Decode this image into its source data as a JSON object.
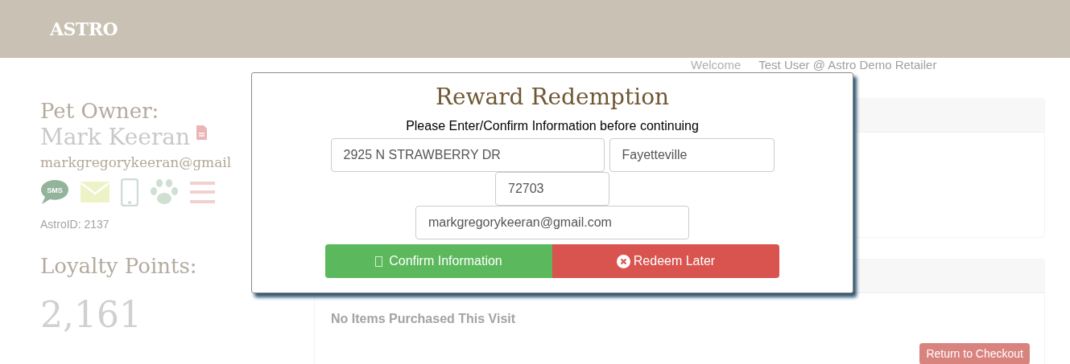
{
  "header": {
    "logo": "ASTRO"
  },
  "greeting": {
    "prefix": "Welcome",
    "user": "Test User @ Astro Demo Retailer"
  },
  "owner": {
    "label": "Pet Owner:",
    "name": "Mark Keeran",
    "email": "markgregorykeeran@gmail",
    "astro_id": "AstroID: 2137",
    "sms_label": "SMS"
  },
  "loyalty": {
    "label": "Loyalty Points:",
    "points": "2,161"
  },
  "purchases": {
    "empty_text": "No Items Purchased This Visit",
    "button": "Return to Checkout"
  },
  "dialog": {
    "title": "Reward Redemption",
    "subtitle": "Please Enter/Confirm Information before continuing",
    "fields": [
      {
        "kind": "street",
        "value": "2925 N STRAWBERRY DR"
      },
      {
        "kind": "city",
        "value": "Fayetteville"
      },
      {
        "kind": "zip",
        "value": "72703"
      },
      {
        "kind": "email",
        "value": "markgregorykeeran@gmail.com"
      }
    ],
    "buttons": [
      {
        "kind": "confirm",
        "label": "Confirm Information"
      },
      {
        "kind": "later",
        "label": "Redeem Later"
      }
    ]
  }
}
